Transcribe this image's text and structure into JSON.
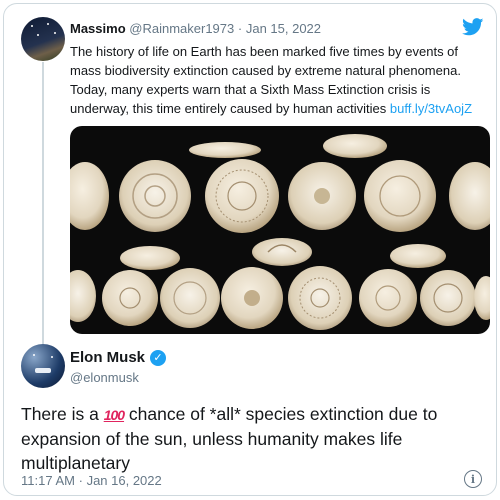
{
  "original_tweet": {
    "author_name": "Massimo",
    "handle": "@Rainmaker1973",
    "separator": "·",
    "date": "Jan 15, 2022",
    "text": "The history of life on Earth has been marked five times by events of mass biodiversity extinction caused by extreme natural phenomena. Today, many experts warn that a Sixth Mass Extinction crisis is underway, this time entirely caused by human activities",
    "link": "buff.ly/3tvAojZ",
    "avatar_icon": "night-sky-avatar",
    "media_icon": "snail-shells-photo"
  },
  "reply_tweet": {
    "author_name": "Elon Musk",
    "handle": "@elonmusk",
    "verified_icon": "verified-badge-icon",
    "text_before": "There is a",
    "emoji": "100",
    "text_after": "chance of *all* species extinction due to expansion of the sun, unless humanity makes life multiplanetary",
    "time": "11:17 AM",
    "separator": "·",
    "date": "Jan 16, 2022"
  },
  "icons": {
    "brand": "twitter-bird-icon",
    "info": "info-icon"
  },
  "colors": {
    "accent": "#1da1f2",
    "muted": "#657786",
    "border": "#cfd9de",
    "emoji_red": "#e0245e"
  }
}
